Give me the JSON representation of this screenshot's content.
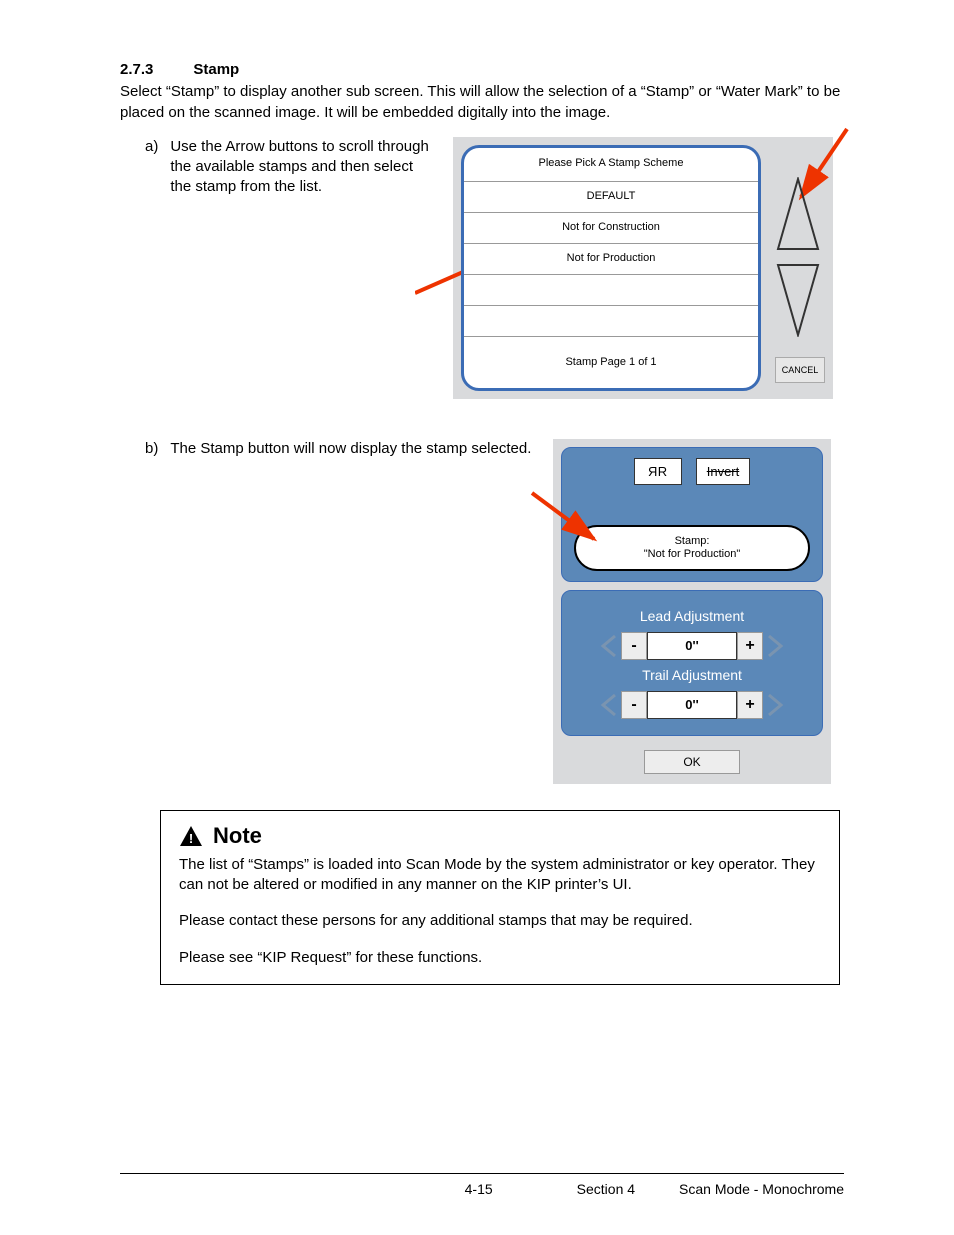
{
  "section": {
    "number": "2.7.3",
    "title": "Stamp"
  },
  "intro": "Select “Stamp” to display another sub screen. This will allow the selection of a “Stamp” or “Water Mark” to be placed on the scanned image. It will be embedded digitally into the image.",
  "step_a": {
    "letter": "a)",
    "text": "Use the Arrow buttons to scroll through the available stamps and then select the stamp from the list."
  },
  "step_b": {
    "letter": "b)",
    "text": "The Stamp button will now display the stamp selected."
  },
  "stamp_panel": {
    "title": "Please Pick A Stamp Scheme",
    "items": [
      "DEFAULT",
      "Not for Construction",
      "Not for Production",
      "",
      "",
      ""
    ],
    "footer": "Stamp Page 1 of 1",
    "cancel": "CANCEL"
  },
  "adj_panel": {
    "mirror": "R",
    "invert": "Invert",
    "stamp_label": "Stamp:",
    "stamp_value": "\"Not for Production\"",
    "lead_label": "Lead Adjustment",
    "lead_value": "0''",
    "trail_label": "Trail Adjustment",
    "trail_value": "0''",
    "ok": "OK"
  },
  "note": {
    "heading": "Note",
    "p1": "The list of “Stamps” is loaded into Scan Mode by the system administrator or key operator. They can not be altered or modified in any manner on the KIP printer’s UI.",
    "p2": "Please contact these persons for any additional stamps that may be required.",
    "p3": "Please see “KIP Request” for these functions."
  },
  "footer": {
    "page": "4-15",
    "section": "Section 4",
    "title": "Scan Mode - Monochrome"
  }
}
